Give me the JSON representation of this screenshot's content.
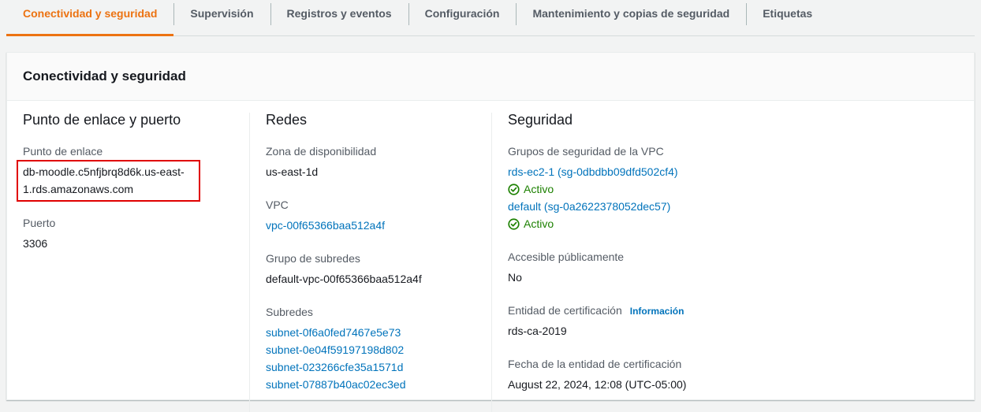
{
  "tabs": [
    {
      "label": "Conectividad y seguridad",
      "active": true
    },
    {
      "label": "Supervisión",
      "active": false
    },
    {
      "label": "Registros y eventos",
      "active": false
    },
    {
      "label": "Configuración",
      "active": false
    },
    {
      "label": "Mantenimiento y copias de seguridad",
      "active": false
    },
    {
      "label": "Etiquetas",
      "active": false
    }
  ],
  "panel": {
    "title": "Conectividad y seguridad"
  },
  "endpoint_section": {
    "title": "Punto de enlace y puerto",
    "endpoint_label": "Punto de enlace",
    "endpoint_line1": "db-moodle.c5nfjbrq8d6k.us-east-",
    "endpoint_line2": "1.rds.amazonaws.com",
    "port_label": "Puerto",
    "port_value": "3306"
  },
  "network_section": {
    "title": "Redes",
    "az_label": "Zona de disponibilidad",
    "az_value": "us-east-1d",
    "vpc_label": "VPC",
    "vpc_value": "vpc-00f65366baa512a4f",
    "subnet_group_label": "Grupo de subredes",
    "subnet_group_value": "default-vpc-00f65366baa512a4f",
    "subnets_label": "Subredes",
    "subnets": [
      "subnet-0f6a0fed7467e5e73",
      "subnet-0e04f59197198d802",
      "subnet-023266cfe35a1571d",
      "subnet-07887b40ac02ec3ed"
    ]
  },
  "security_section": {
    "title": "Seguridad",
    "sg_label": "Grupos de seguridad de la VPC",
    "security_groups": [
      {
        "name": "rds-ec2-1 (sg-0dbdbb09dfd502cf4)",
        "status": "Activo"
      },
      {
        "name": "default (sg-0a2622378052dec57)",
        "status": "Activo"
      }
    ],
    "public_label": "Accesible públicamente",
    "public_value": "No",
    "ca_label": "Entidad de certificación",
    "ca_info": "Información",
    "ca_value": "rds-ca-2019",
    "ca_date_label": "Fecha de la entidad de certificación",
    "ca_date_value": "August 22, 2024, 12:08 (UTC-05:00)"
  },
  "colors": {
    "accent": "#ec7211",
    "link": "#0073bb",
    "success": "#1d8102",
    "highlight_box": "#e00000"
  }
}
